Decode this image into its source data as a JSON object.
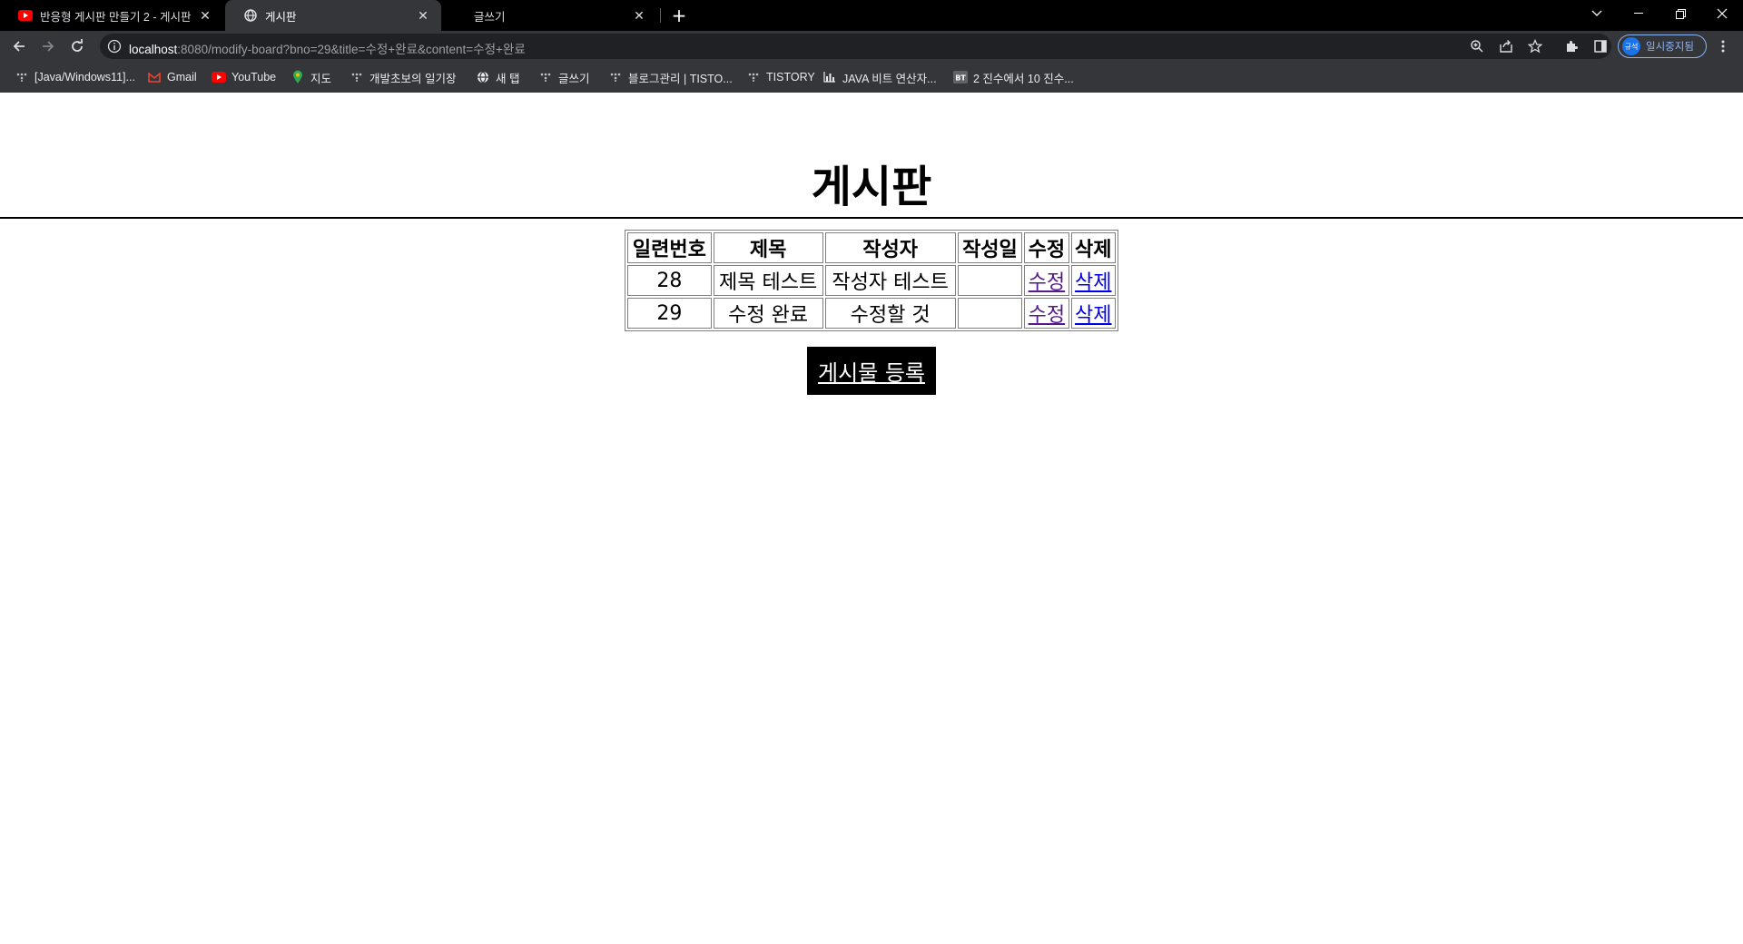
{
  "tabs": [
    {
      "title": "반응형 게시판 만들기 2 - 게시판",
      "icon": "youtube-icon",
      "active": false
    },
    {
      "title": "게시판",
      "icon": "globe-icon",
      "active": true
    },
    {
      "title": "글쓰기",
      "icon": "",
      "active": false
    }
  ],
  "address_bar": {
    "host": "localhost",
    "path": ":8080/modify-board?bno=29&title=수정+완료&content=수정+완료"
  },
  "profile": {
    "avatar_text": "규석",
    "label": "일시중지됨"
  },
  "bookmarks": [
    {
      "label": "[Java/Windows11]...",
      "icon": "tistory-icon"
    },
    {
      "label": "Gmail",
      "icon": "gmail-icon"
    },
    {
      "label": "YouTube",
      "icon": "youtube-icon"
    },
    {
      "label": "지도",
      "icon": "maps-icon"
    },
    {
      "label": "개발초보의 일기장",
      "icon": "tistory-icon"
    },
    {
      "label": "새 탭",
      "icon": "globe-icon"
    },
    {
      "label": "글쓰기",
      "icon": "tistory-icon"
    },
    {
      "label": "블로그관리 | TISTO...",
      "icon": "tistory-icon"
    },
    {
      "label": "TISTORY",
      "icon": "tistory-icon"
    },
    {
      "label": "JAVA 비트 연산자...",
      "icon": "chart-icon"
    },
    {
      "label": "2 진수에서 10 진수...",
      "icon": "bt-icon"
    }
  ],
  "page": {
    "title": "게시판",
    "table": {
      "headers": [
        "일련번호",
        "제목",
        "작성자",
        "작성일",
        "수정",
        "삭제"
      ],
      "rows": [
        {
          "bno": "28",
          "title": "제목 테스트",
          "writer": "작성자 테스트",
          "date": "",
          "edit": "수정",
          "delete": "삭제"
        },
        {
          "bno": "29",
          "title": "수정 완료",
          "writer": "수정할 것",
          "date": "",
          "edit": "수정",
          "delete": "삭제"
        }
      ]
    },
    "register_button": "게시물 등록"
  }
}
